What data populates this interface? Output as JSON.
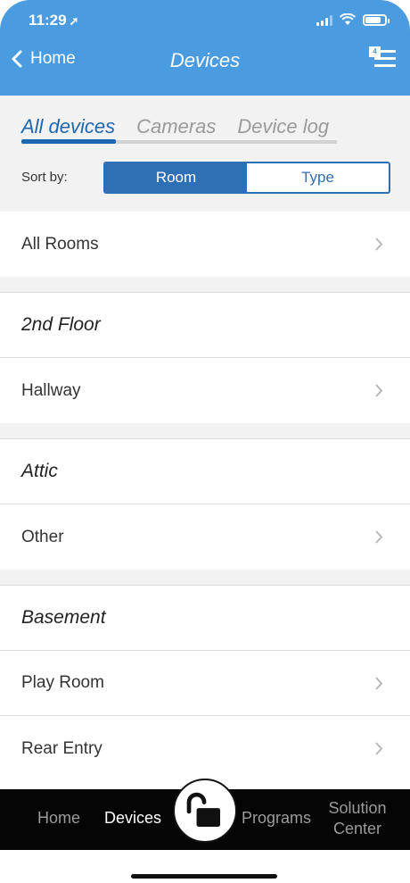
{
  "status_bar": {
    "time": "11:29",
    "location_glyph": "➚"
  },
  "header": {
    "back_label": "Home",
    "title": "Devices",
    "menu_badge": "4"
  },
  "tabs": [
    {
      "label": "All devices",
      "active": true
    },
    {
      "label": "Cameras",
      "active": false
    },
    {
      "label": "Device log",
      "active": false
    }
  ],
  "sort": {
    "label": "Sort by:",
    "options": [
      "Room",
      "Type"
    ],
    "selected": "Room"
  },
  "list": {
    "all_rooms": "All Rooms",
    "sections": [
      {
        "title": "2nd Floor",
        "rooms": [
          "Hallway"
        ]
      },
      {
        "title": "Attic",
        "rooms": [
          "Other"
        ]
      },
      {
        "title": "Basement",
        "rooms": [
          "Play Room",
          "Rear Entry"
        ]
      }
    ]
  },
  "bottom_nav": {
    "home": "Home",
    "devices": "Devices",
    "programs": "Programs",
    "solution_line1": "Solution",
    "solution_line2": "Center"
  },
  "colors": {
    "header_blue": "#4a9be0",
    "accent_blue": "#1f66b0",
    "nav_bg": "#050505"
  }
}
